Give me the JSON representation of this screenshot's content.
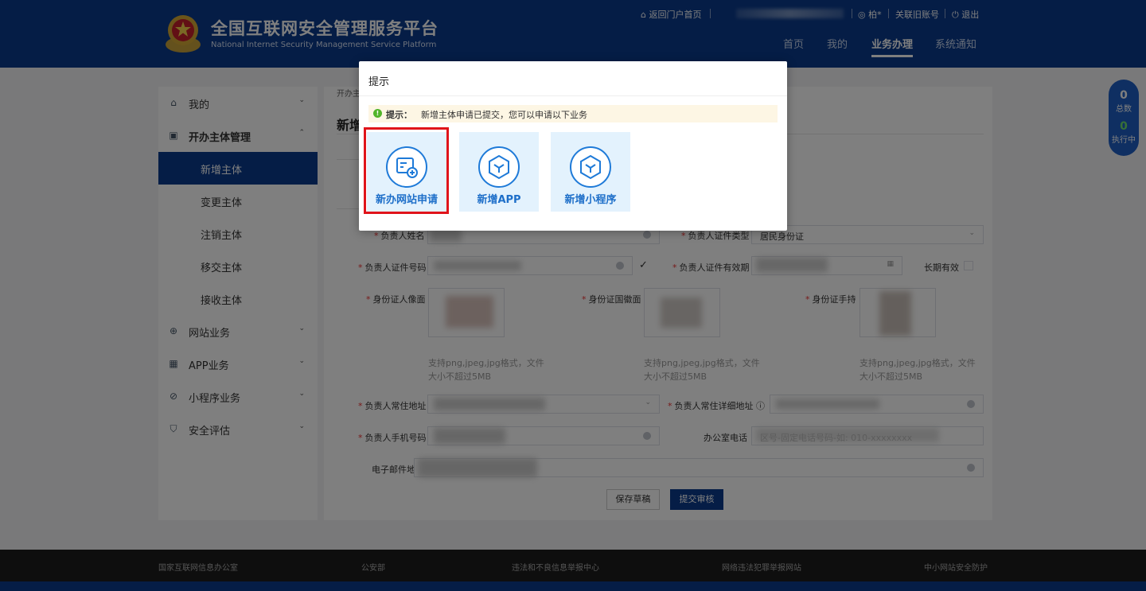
{
  "header": {
    "title": "全国互联网安全管理服务平台",
    "subtitle": "National Internet Security Management Service Platform",
    "back_portal": "返回门户首页",
    "user": "柏*",
    "link_old": "关联旧账号",
    "logout": "退出",
    "nav": [
      "首页",
      "我的",
      "业务办理",
      "系统通知"
    ]
  },
  "sidebar": {
    "items": [
      {
        "label": "我的"
      },
      {
        "label": "开办主体管理"
      },
      {
        "label": "新增主体"
      },
      {
        "label": "变更主体"
      },
      {
        "label": "注销主体"
      },
      {
        "label": "移交主体"
      },
      {
        "label": "接收主体"
      },
      {
        "label": "网站业务"
      },
      {
        "label": "APP业务"
      },
      {
        "label": "小程序业务"
      },
      {
        "label": "安全评估"
      }
    ]
  },
  "content": {
    "crumb": "开办主",
    "heading": "新增",
    "form": {
      "name_label": "负责人姓名",
      "id_type_label": "负责人证件类型",
      "id_type_value": "居民身份证",
      "id_no_label": "负责人证件号码",
      "id_valid_label": "负责人证件有效期",
      "long_term_label": "长期有效",
      "photo_front_label": "身份证人像面",
      "photo_back_label": "身份证国徽面",
      "photo_hand_label": "身份证手持",
      "upload_hint": "支持png,jpeg,jpg格式，文件大小不超过5MB",
      "address_label": "负责人常住地址",
      "address_detail_label": "负责人常住详细地址",
      "phone_label": "负责人手机号码",
      "office_phone_label": "办公室电话",
      "office_phone_placeholder": "区号-固定电话号码-如: 010-xxxxxxxx",
      "email_label": "电子邮件地"
    },
    "save_draft": "保存草稿",
    "submit": "提交审核"
  },
  "float_badge": {
    "total_count": "0",
    "total_label": "总数",
    "running_count": "0",
    "running_label": "执行中"
  },
  "footer": [
    "国家互联网信息办公室",
    "公安部",
    "违法和不良信息举报中心",
    "网络违法犯罪举报网站",
    "中小网站安全防护"
  ],
  "modal": {
    "title": "提示",
    "notice_label": "提示：",
    "notice_text": "新增主体申请已提交，您可以申请以下业务",
    "cards": [
      {
        "label": "新办网站申请",
        "icon": "website-apply-icon"
      },
      {
        "label": "新增APP",
        "icon": "cube-icon"
      },
      {
        "label": "新增小程序",
        "icon": "cube-icon"
      }
    ]
  },
  "colors": {
    "primary": "#0a3a8c",
    "card_bg": "#e3f2fd",
    "highlight": "#e0141b"
  }
}
